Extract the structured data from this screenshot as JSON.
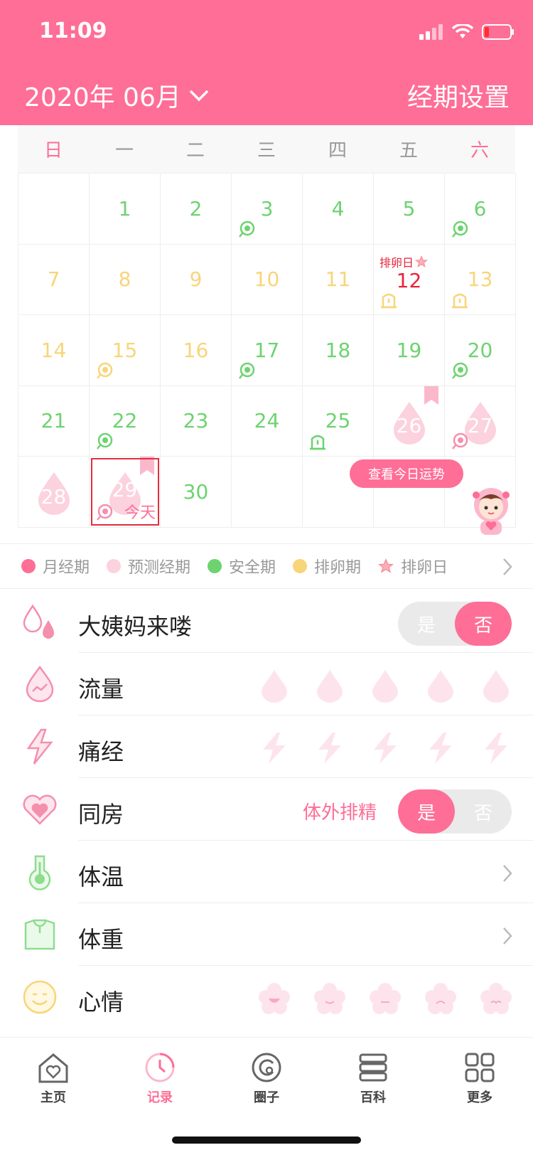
{
  "status_bar": {
    "time": "11:09"
  },
  "header": {
    "month": "2020年 06月",
    "settings": "经期设置"
  },
  "calendar": {
    "weekdays": [
      "日",
      "一",
      "二",
      "三",
      "四",
      "五",
      "六"
    ],
    "days": [
      "1",
      "2",
      "3",
      "4",
      "5",
      "6",
      "7",
      "8",
      "9",
      "10",
      "11",
      "12",
      "13",
      "14",
      "15",
      "16",
      "17",
      "18",
      "19",
      "20",
      "21",
      "22",
      "23",
      "24",
      "25",
      "26",
      "27",
      "28",
      "29",
      "30"
    ],
    "ovulation_label": "排卵日",
    "today_label": "今天",
    "fortune_button": "查看今日运势"
  },
  "legend": {
    "items": [
      {
        "label": "月经期",
        "color": "#fe6e96"
      },
      {
        "label": "预测经期",
        "color": "#fcd2de"
      },
      {
        "label": "安全期",
        "color": "#6dd36f"
      },
      {
        "label": "排卵期",
        "color": "#f8d57a"
      },
      {
        "label": "排卵日",
        "color": "#f78f98"
      }
    ]
  },
  "rows": {
    "period": {
      "label": "大姨妈来喽",
      "yes": "是",
      "no": "否",
      "selected": "否"
    },
    "flow": {
      "label": "流量"
    },
    "pain": {
      "label": "痛经"
    },
    "intimacy": {
      "label": "同房",
      "extra": "体外排精",
      "yes": "是",
      "no": "否",
      "selected": "是"
    },
    "temperature": {
      "label": "体温"
    },
    "weight": {
      "label": "体重"
    },
    "mood": {
      "label": "心情"
    }
  },
  "nav": {
    "home": "主页",
    "record": "记录",
    "circle": "圈子",
    "wiki": "百科",
    "more": "更多"
  }
}
